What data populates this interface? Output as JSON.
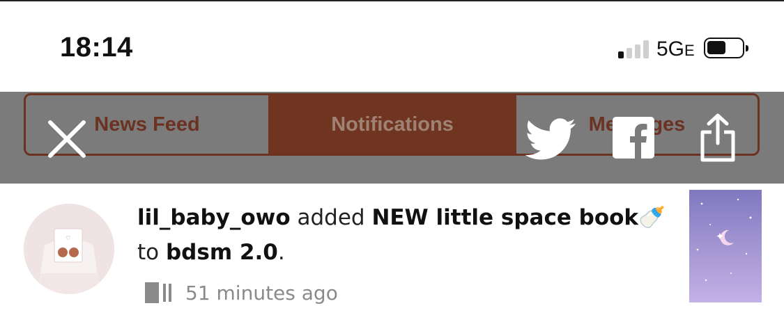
{
  "status_bar": {
    "time": "18:14",
    "network": "5G",
    "network_suffix": "E"
  },
  "tabs": [
    {
      "label": "News Feed",
      "active": false
    },
    {
      "label": "Notifications",
      "active": true
    },
    {
      "label": "Messages",
      "active": false
    }
  ],
  "share_overlay": {
    "icons": [
      "close-icon",
      "twitter-icon",
      "facebook-icon",
      "share-icon"
    ]
  },
  "notification": {
    "user": "lil_baby_owo",
    "action": " added ",
    "item": "NEW little space book",
    "item_emoji": "🍼",
    "to_text": "to ",
    "target": "bdsm 2.0",
    "period": ".",
    "time_ago": "51 minutes ago"
  },
  "colors": {
    "accent_brown": "#6f3521",
    "overlay_gray": "#7b7b7b"
  }
}
